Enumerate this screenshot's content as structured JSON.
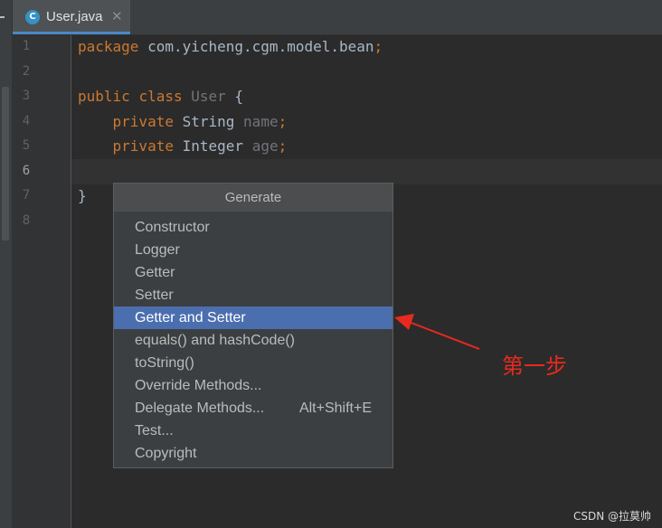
{
  "tab": {
    "icon_letter": "C",
    "label": "User.java",
    "close": "✕"
  },
  "gutter": {
    "line_numbers": [
      "1",
      "2",
      "3",
      "4",
      "5",
      "6",
      "7",
      "8"
    ],
    "active_line": "6"
  },
  "code": {
    "line1": {
      "kw": "package",
      "rest": " com.yicheng.cgm.model.bean",
      "semi": ";"
    },
    "line3": {
      "kw1": "public",
      "kw2": "class",
      "name": "User",
      "brace": " {"
    },
    "line4": {
      "kw": "private",
      "type": "String",
      "field": "name",
      "semi": ";"
    },
    "line5": {
      "kw": "private",
      "type": "Integer",
      "field": "age",
      "semi": ";"
    },
    "line7": {
      "brace": "}"
    }
  },
  "popup": {
    "title": "Generate",
    "items": [
      {
        "label": "Constructor"
      },
      {
        "label": "Logger"
      },
      {
        "label": "Getter"
      },
      {
        "label": "Setter"
      },
      {
        "label": "Getter and Setter"
      },
      {
        "label": "equals() and hashCode()"
      },
      {
        "label": "toString()"
      },
      {
        "label": "Override Methods..."
      },
      {
        "label": "Delegate Methods...",
        "shortcut": "Alt+Shift+E"
      },
      {
        "label": "Test..."
      },
      {
        "label": "Copyright"
      }
    ],
    "selected_index": 4
  },
  "annotation": {
    "text": "第一步",
    "color": "#e8291f"
  },
  "watermark": "CSDN @拉莫帅",
  "colors": {
    "accent": "#4b6eaf",
    "keyword": "#cc7832",
    "background": "#2b2b2b"
  }
}
